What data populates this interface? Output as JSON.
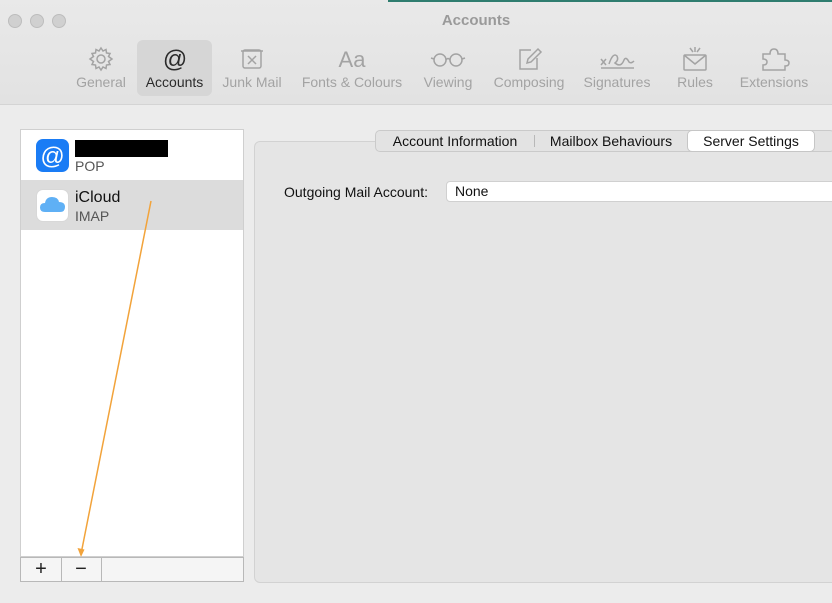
{
  "window": {
    "title": "Accounts"
  },
  "toolbar": {
    "items": [
      {
        "label": "General",
        "icon": "gear-icon"
      },
      {
        "label": "Accounts",
        "icon": "at-sign-icon",
        "active": true
      },
      {
        "label": "Junk Mail",
        "icon": "junk-mail-icon"
      },
      {
        "label": "Fonts & Colours",
        "icon": "fonts-icon",
        "glyph": "Aa"
      },
      {
        "label": "Viewing",
        "icon": "glasses-icon"
      },
      {
        "label": "Composing",
        "icon": "compose-icon"
      },
      {
        "label": "Signatures",
        "icon": "signature-icon"
      },
      {
        "label": "Rules",
        "icon": "rules-icon"
      },
      {
        "label": "Extensions",
        "icon": "extensions-icon"
      }
    ]
  },
  "accounts": [
    {
      "name": "",
      "type": "POP",
      "name_redacted": true,
      "icon": "at-sign-icon"
    },
    {
      "name": "iCloud",
      "type": "IMAP",
      "icon": "cloud-icon",
      "selected": true
    }
  ],
  "list_footer": {
    "add": "+",
    "remove": "−"
  },
  "tabs": [
    {
      "label": "Account Information"
    },
    {
      "label": "Mailbox Behaviours"
    },
    {
      "label": "Server Settings",
      "selected": true
    }
  ],
  "server_settings": {
    "outgoing_label": "Outgoing Mail Account:",
    "outgoing_value": "None"
  },
  "colors": {
    "annotation_arrow": "#f2a33a",
    "at_icon_blue": "#1a7cf5",
    "selection_gray": "#dcdcdc"
  }
}
